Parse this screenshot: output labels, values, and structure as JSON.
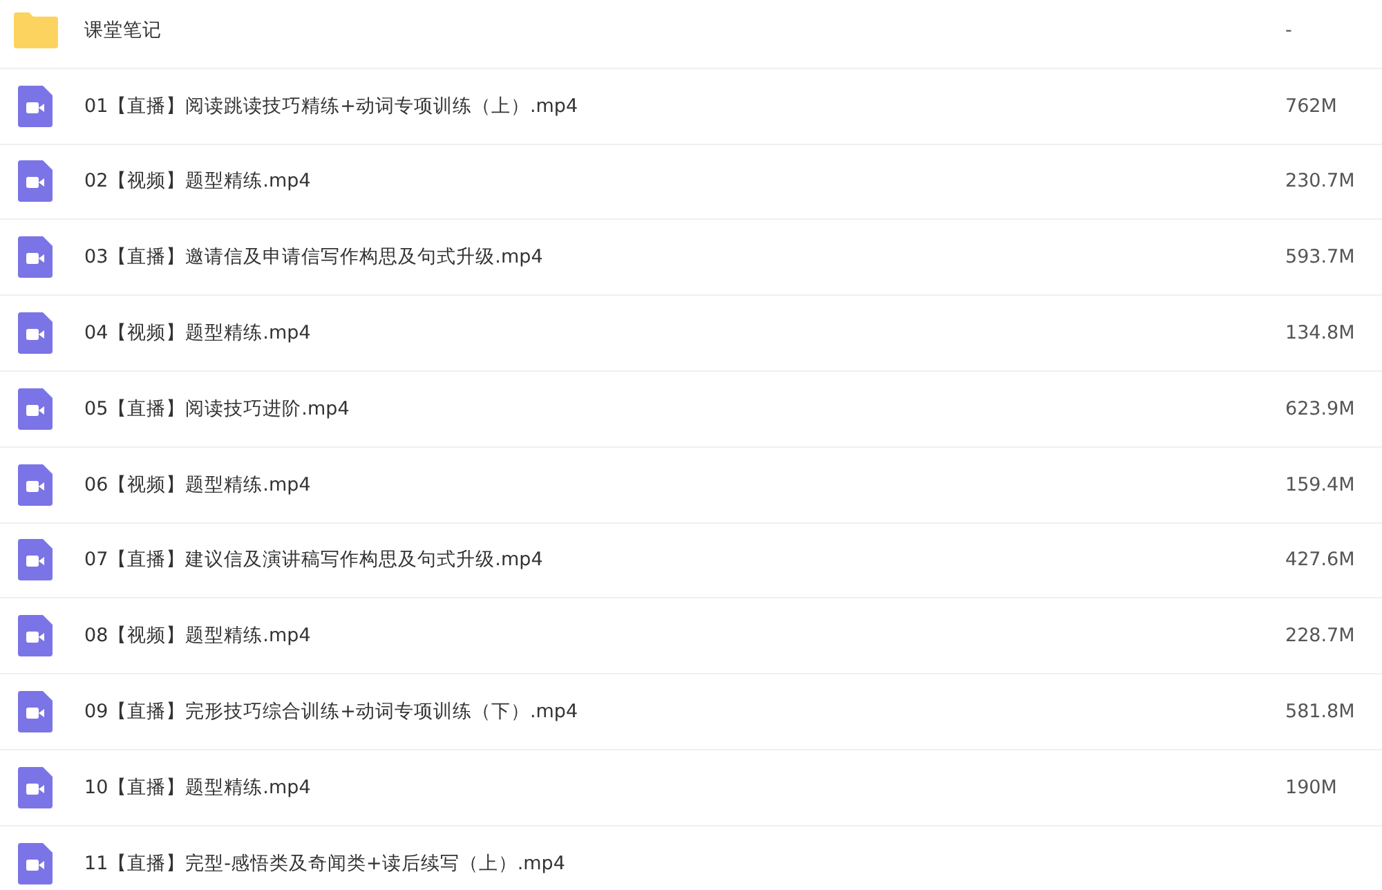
{
  "files": [
    {
      "kind": "folder",
      "name": "课堂笔记",
      "size": "-"
    },
    {
      "kind": "video",
      "name": "01【直播】阅读跳读技巧精练+动词专项训练（上）.mp4",
      "size": "762M"
    },
    {
      "kind": "video",
      "name": "02【视频】题型精练.mp4",
      "size": "230.7M"
    },
    {
      "kind": "video",
      "name": "03【直播】邀请信及申请信写作构思及句式升级.mp4",
      "size": "593.7M"
    },
    {
      "kind": "video",
      "name": "04【视频】题型精练.mp4",
      "size": "134.8M"
    },
    {
      "kind": "video",
      "name": "05【直播】阅读技巧进阶.mp4",
      "size": "623.9M"
    },
    {
      "kind": "video",
      "name": "06【视频】题型精练.mp4",
      "size": "159.4M"
    },
    {
      "kind": "video",
      "name": "07【直播】建议信及演讲稿写作构思及句式升级.mp4",
      "size": "427.6M"
    },
    {
      "kind": "video",
      "name": "08【视频】题型精练.mp4",
      "size": "228.7M"
    },
    {
      "kind": "video",
      "name": "09【直播】完形技巧综合训练+动词专项训练（下）.mp4",
      "size": "581.8M"
    },
    {
      "kind": "video",
      "name": "10【直播】题型精练.mp4",
      "size": "190M"
    },
    {
      "kind": "video",
      "name": "11【直播】完型-感悟类及奇闻类+读后续写（上）.mp4"
    }
  ]
}
